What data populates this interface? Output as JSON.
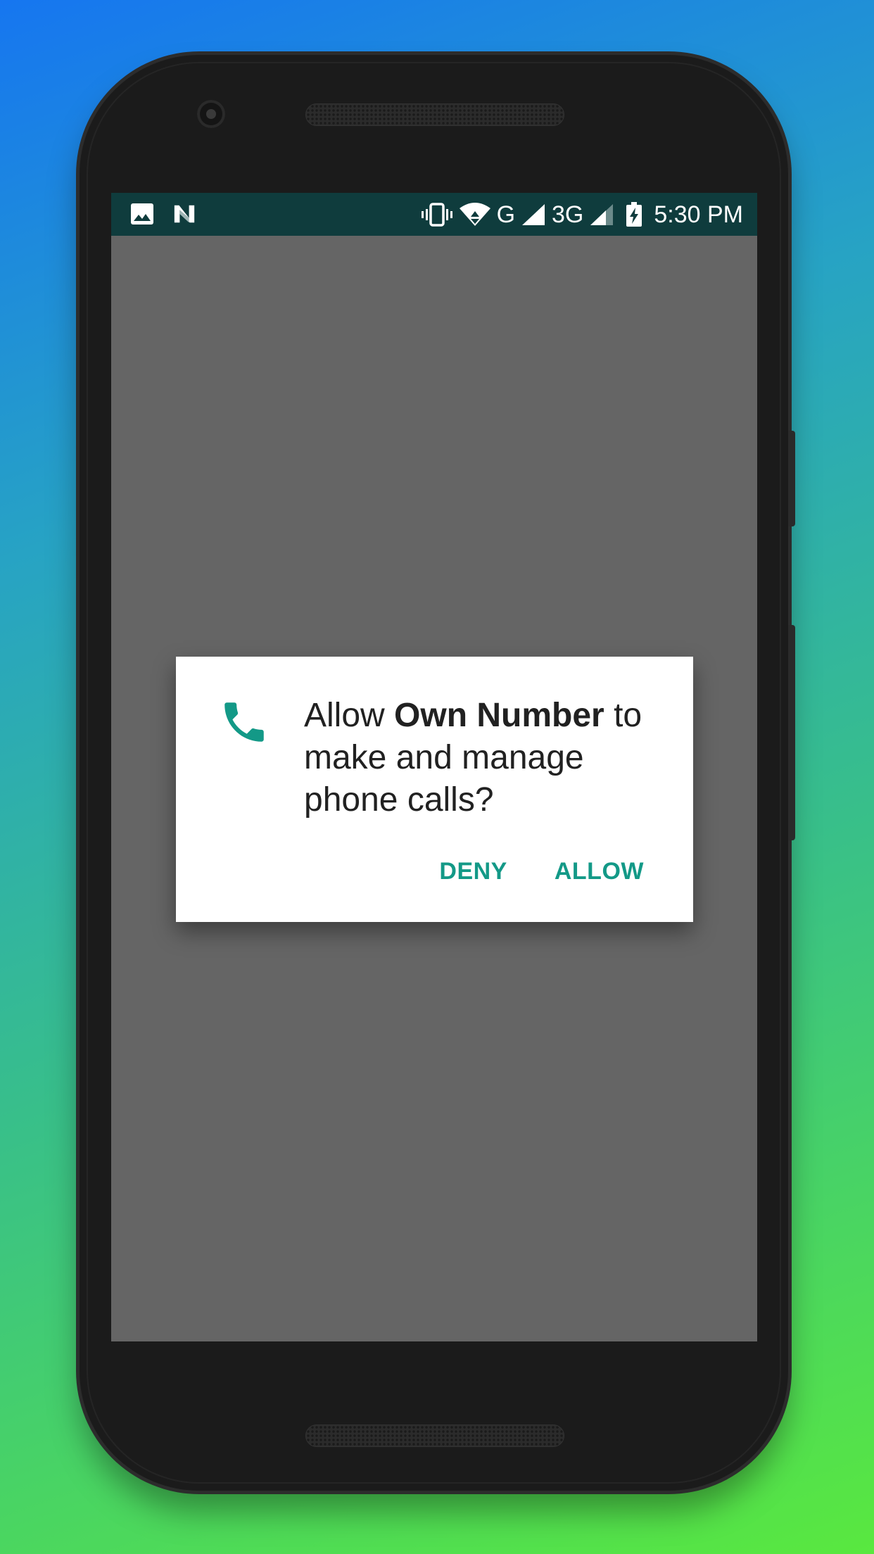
{
  "status_bar": {
    "left_icons": [
      "image-icon",
      "n-notification-icon"
    ],
    "right_icons": [
      "vibrate-icon",
      "wifi-icon",
      "signal-icon",
      "signal-icon",
      "battery-charging-icon"
    ],
    "network_g": "G",
    "network_3g": "3G",
    "time": "5:30 PM"
  },
  "dialog": {
    "icon": "phone-icon",
    "message_prefix": "Allow ",
    "app_name": "Own Number",
    "message_suffix": " to make and manage phone calls?",
    "deny_label": "DENY",
    "allow_label": "ALLOW"
  },
  "colors": {
    "accent": "#139987",
    "status_bar": "#0f3c3d",
    "scrim": "#656565"
  }
}
